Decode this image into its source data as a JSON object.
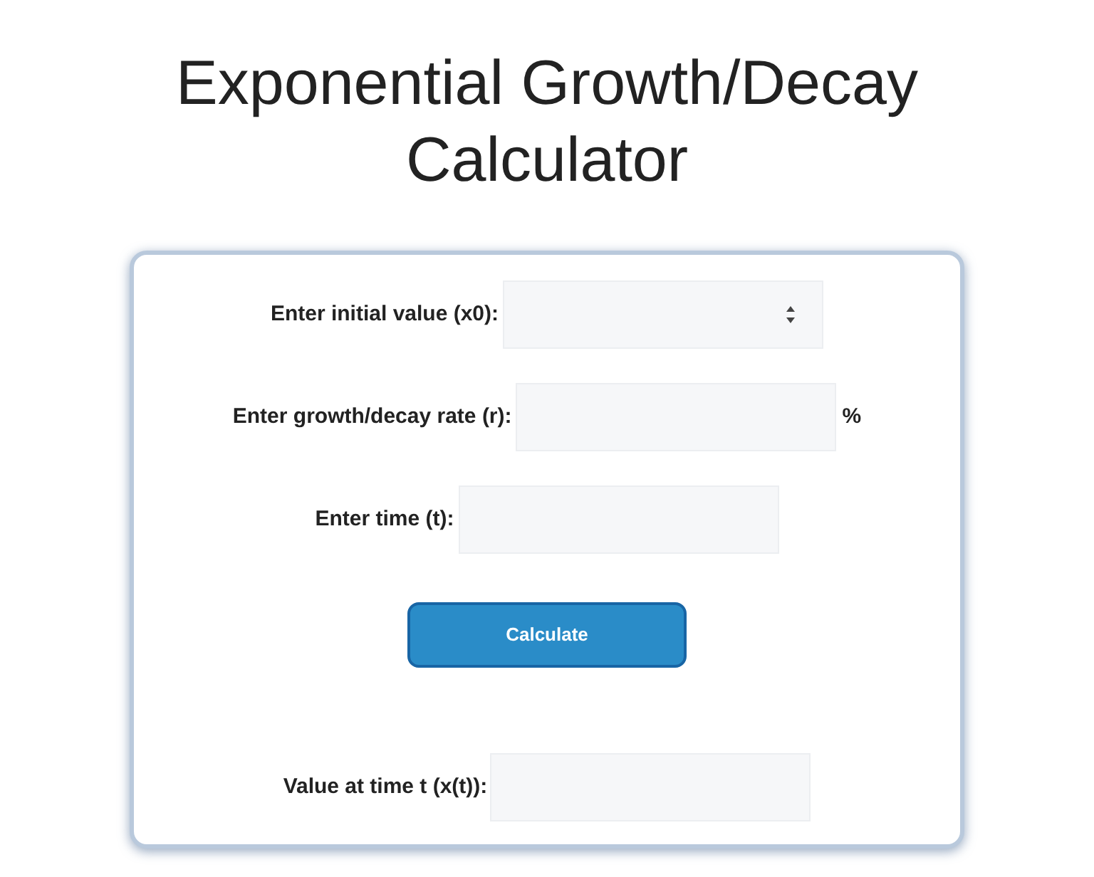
{
  "title": "Exponential Growth/Decay Calculator",
  "fields": [
    {
      "label": "Enter initial value (x0):",
      "kind": "number"
    },
    {
      "label": "Enter growth/decay rate (r):",
      "kind": "text",
      "suffix": "%"
    },
    {
      "label": "Enter time (t):",
      "kind": "text"
    }
  ],
  "button": "Calculate",
  "result": {
    "label": "Value at time t (x(t)):"
  }
}
